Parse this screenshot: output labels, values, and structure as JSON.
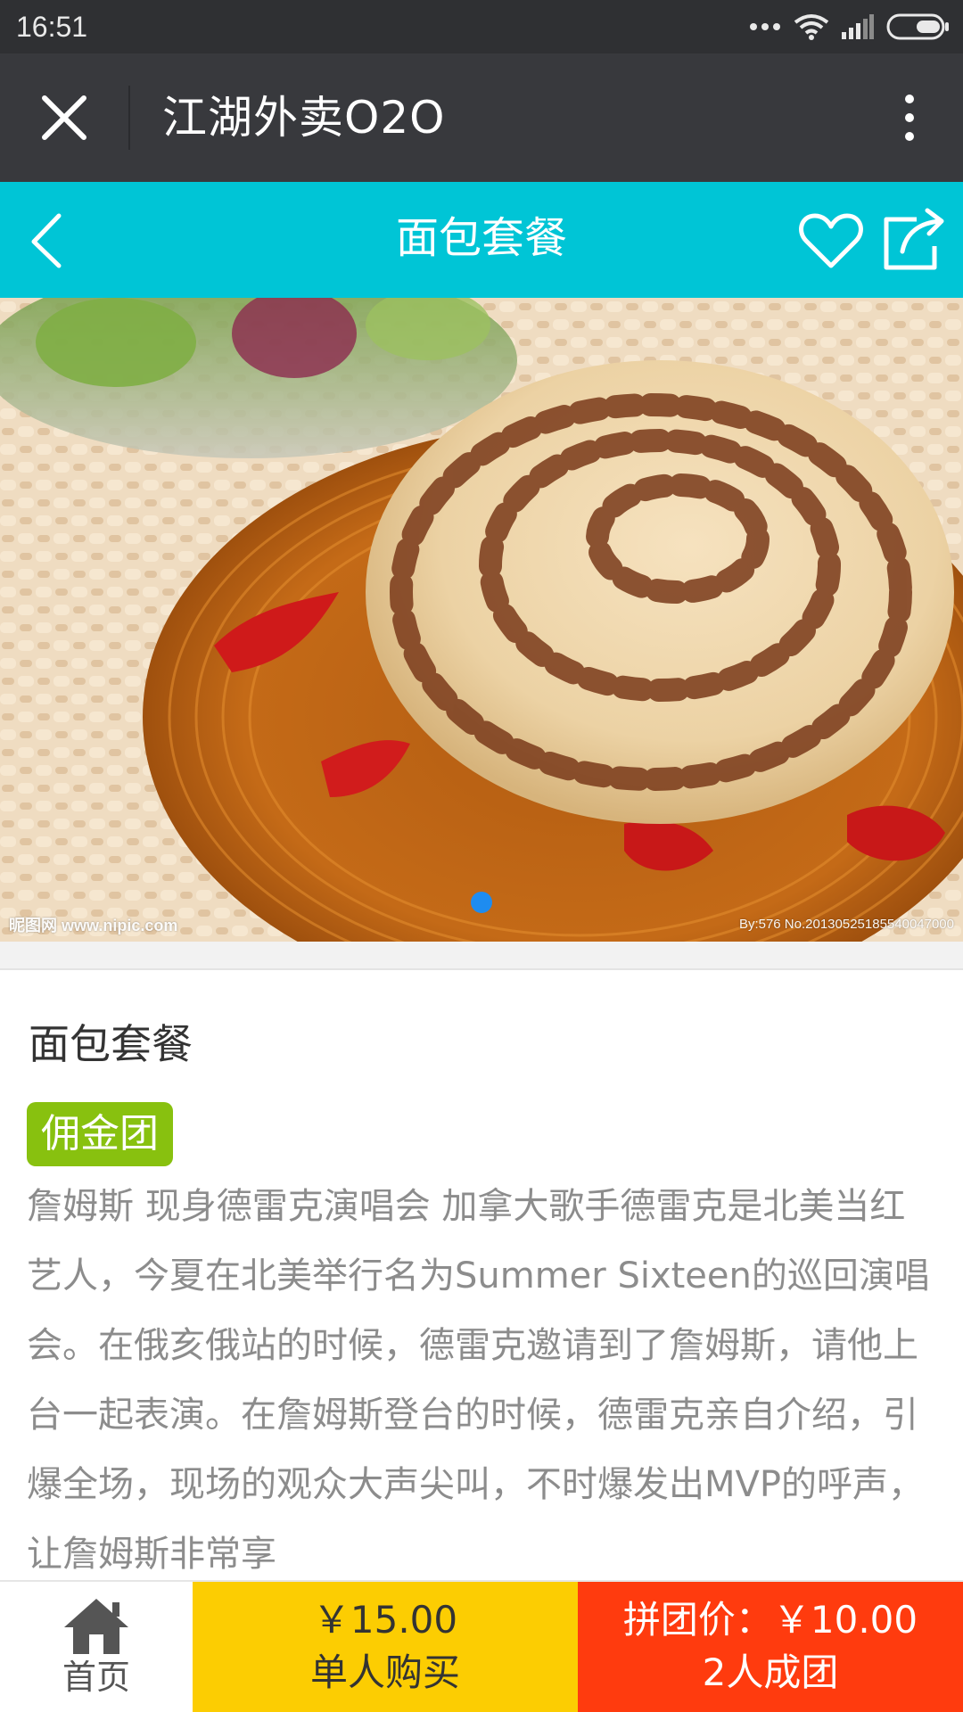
{
  "status_bar": {
    "time": "16:51"
  },
  "title_bar": {
    "app_title": "江湖外卖O2O"
  },
  "nav_header": {
    "title": "面包套餐",
    "accent_color": "#00c5d6"
  },
  "hero": {
    "watermark_left": "昵图网 www.nipic.com",
    "watermark_right": "By:576 No.20130525185540047000",
    "active_slide_indicator_color": "#1e8cf0"
  },
  "product": {
    "title": "面包套餐",
    "badge": "佣金团",
    "badge_color": "#88c10f",
    "description": "詹姆斯 现身德雷克演唱会 加拿大歌手德雷克是北美当红艺人，今夏在北美举行名为Summer Sixteen的巡回演唱会。在俄亥俄站的时候，德雷克邀请到了詹姆斯，请他上台一起表演。在詹姆斯登台的时候，德雷克亲自介绍，引爆全场，现场的观众大声尖叫，不时爆发出MVP的呼声，让詹姆斯非常享"
  },
  "bottom_bar": {
    "home_label": "首页",
    "single_price": "￥15.00",
    "single_label": "单人购买",
    "group_price": "拼团价：￥10.00",
    "group_label": "2人成团",
    "single_color": "#fccd02",
    "group_color": "#ff3b0e"
  },
  "icons": [
    "signal-dots-icon",
    "wifi-icon",
    "cell-signal-icon",
    "battery-icon",
    "close-icon",
    "more-vertical-icon",
    "back-chevron-icon",
    "heart-icon",
    "share-icon",
    "home-icon"
  ]
}
